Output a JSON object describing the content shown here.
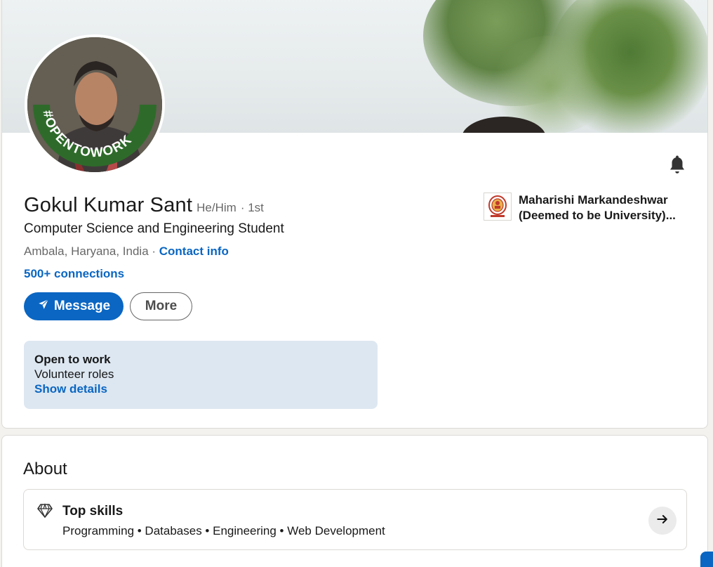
{
  "profile": {
    "name": "Gokul Kumar Sant",
    "pronouns": "He/Him",
    "degree": "· 1st",
    "headline": "Computer Science and Engineering Student",
    "location": "Ambala, Haryana, India",
    "location_sep": " · ",
    "contact_label": "Contact info",
    "connections": "500+ connections",
    "avatar_badge": "#OPENTOWORK"
  },
  "actions": {
    "message_label": "Message",
    "more_label": "More"
  },
  "open_to_work": {
    "title": "Open to work",
    "roles": "Volunteer roles",
    "link": "Show details"
  },
  "education": {
    "name": "Maharishi Markandeshwar (Deemed to be University)..."
  },
  "about": {
    "title": "About",
    "top_skills_title": "Top skills",
    "top_skills": "Programming • Databases • Engineering • Web Development"
  },
  "colors": {
    "accent": "#0a66c2",
    "otw_green": "#2e6b2a",
    "otw_box": "#dde7f1"
  },
  "icons": [
    "bell-icon",
    "send-icon",
    "diamond-icon",
    "arrow-right-icon",
    "university-logo"
  ]
}
